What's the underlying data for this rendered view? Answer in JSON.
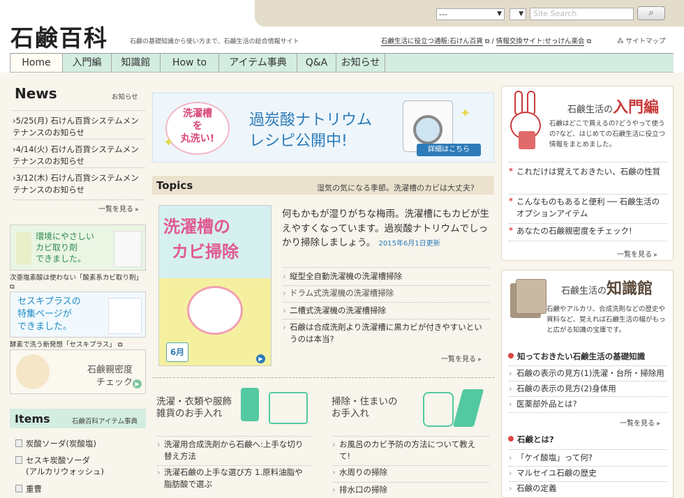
{
  "header": {
    "logo": "石鹸百科",
    "tagline": "石鹸の基礎知識から使い方まで、石鹸生活の総合情報サイト",
    "select1": "---",
    "select2": "",
    "search_placeholder": "Site Search",
    "link1": "石鹸生活に役立つ通販:石けん百貨",
    "link2": "情報交換サイト:せっけん楽会",
    "sitemap": "サイトマップ"
  },
  "nav": [
    "Home",
    "入門編",
    "知識館",
    "How to",
    "アイテム事典",
    "Q&A",
    "お知らせ"
  ],
  "news": {
    "title": "News",
    "link": "お知らせ",
    "items": [
      "5/25(月) 石けん百貨システムメンテナンスのお知らせ",
      "4/14(火) 石けん百貨システムメンテナンスのお知らせ",
      "3/12(木) 石けん百貨システムメンテナンスのお知らせ"
    ],
    "more": "一覧を見る"
  },
  "left_banners": {
    "b1_text": "環境にやさしい\nカビ取り剤\nできました。",
    "b1_caption": "次亜塩素酸は使わない「酸素系カビ取り剤」",
    "b2_text": "セスキプラスの\n特集ページが\nできました。",
    "b2_caption": "酵素で洗う新発想「セスキプラス」",
    "b3_text": "石鹸親密度\nチェック"
  },
  "items": {
    "title": "Items",
    "link": "石鹸百科アイテム事典",
    "list": [
      "炭酸ソーダ(炭酸塩)",
      "セスキ炭酸ソーダ\n(アルカリウォッシュ)",
      "重曹"
    ]
  },
  "center_banner": {
    "left": "洗濯槽\nを\n丸洗い!",
    "main1": "過炭酸ナトリウム",
    "main2": "レシピ公開中!",
    "detail": "詳細はこちら"
  },
  "topics": {
    "title": "Topics",
    "sub": "湿気の気になる季節。洗濯槽のカビは大丈夫?",
    "img_title1": "洗濯槽の",
    "img_title2": "カビ掃除",
    "img_month": "6月",
    "lead": "何もかもが湿りがちな梅雨。洗濯槽にもカビが生えやすくなっています。過炭酸ナトリウムでしっかり掃除しましょう。",
    "date": "2015年6月1日更新",
    "list": [
      "縦型全自動洗濯機の洗濯槽掃除",
      "ドラム式洗濯機の洗濯槽掃除",
      "二槽式洗濯機の洗濯槽掃除",
      "石鹸は合成洗剤より洗濯槽に黒カビが付きやすいというのは本当?"
    ],
    "more": "一覧を見る"
  },
  "categories": {
    "laundry_title": "洗濯・衣類や服飾\n雑貨のお手入れ",
    "laundry_list": [
      "洗濯用合成洗剤から石鹸へ:上手な切り替え方法",
      "洗濯石鹸の上手な選び方 1.原料油脂や脂肪酸で選ぶ"
    ],
    "house_title": "掃除・住まいの\nお手入れ",
    "house_list": [
      "お風呂のカビ予防の方法について教えて!",
      "水周りの掃除",
      "排水口の掃除"
    ]
  },
  "intro": {
    "title_small": "石鹸生活の",
    "title_big": "入門編",
    "desc": "石鹸はどこで買えるの?どうやって使うの?など、はじめての石鹸生活に役立つ情報をまとめました。",
    "list": [
      "これだけは覚えておきたい、石鹸の性質",
      "こんなものもあると便利 ── 石鹸生活のオプションアイテム",
      "あなたの石鹸親密度をチェック!"
    ],
    "more": "一覧を見る"
  },
  "knowledge": {
    "title_small": "石鹸生活の",
    "title_big": "知識館",
    "desc": "石鹸やアルカリ、合成洗剤などの歴史や資料など、覚えれば石鹸生活の幅がもっと広がる知識の宝庫です。",
    "head1": "知っておきたい石鹸生活の基礎知識",
    "list1": [
      "石鹸の表示の見方(1)洗濯・台所・掃除用",
      "石鹸の表示の見方(2)身体用",
      "医薬部外品とは?"
    ],
    "more": "一覧を見る",
    "head2": "石鹸とは?",
    "list2": [
      "「ケイ酸塩」って何?",
      "マルセイユ石鹸の歴史",
      "石鹸の定義"
    ]
  },
  "colors": {
    "accent": "#d8443f",
    "nav_bg": "#d3ede1",
    "beige": "#ebe2ce",
    "blue": "#2d7bb8"
  }
}
